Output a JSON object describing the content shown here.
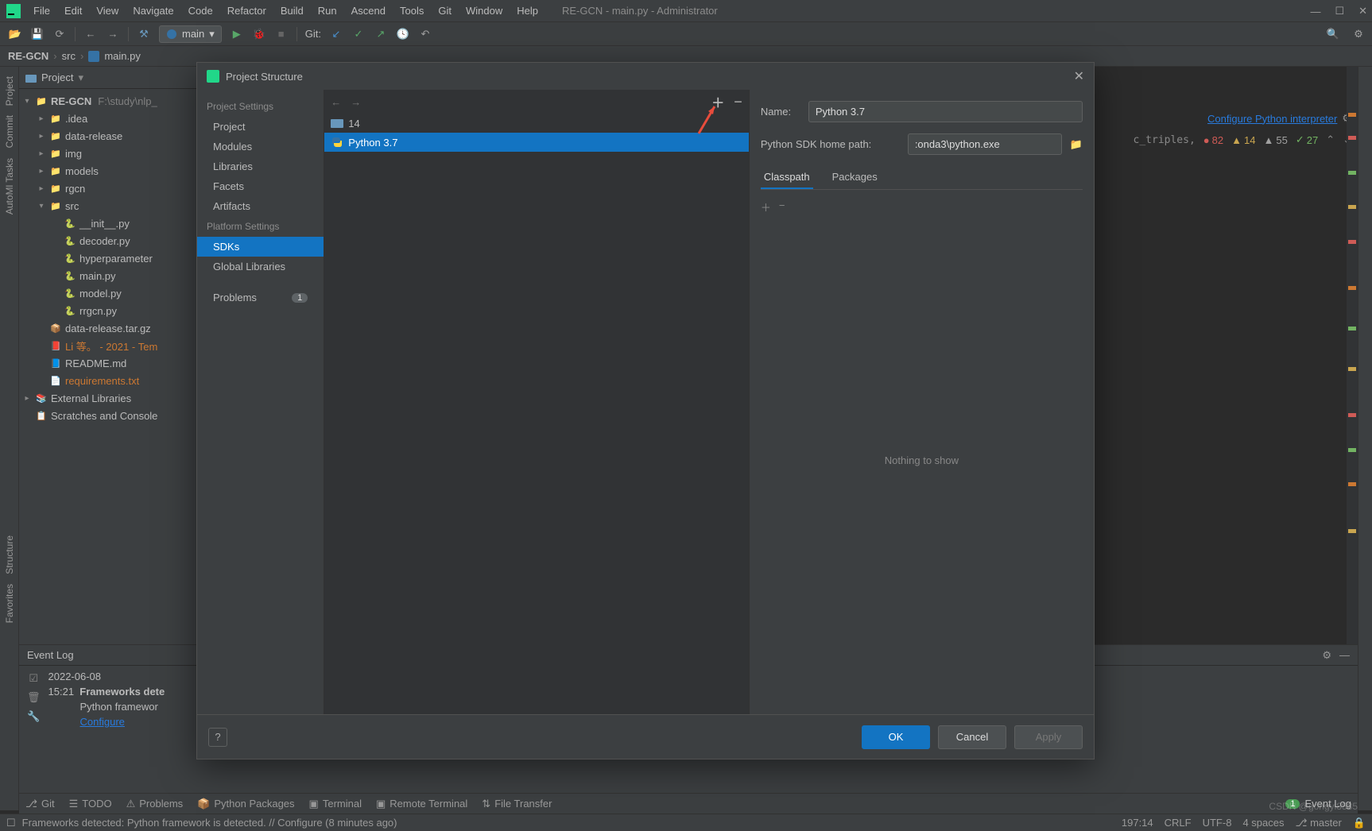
{
  "window": {
    "title": "RE-GCN - main.py - Administrator"
  },
  "menu": {
    "items": [
      "File",
      "Edit",
      "View",
      "Navigate",
      "Code",
      "Refactor",
      "Build",
      "Run",
      "Ascend",
      "Tools",
      "Git",
      "Window",
      "Help"
    ]
  },
  "toolbar": {
    "git_label": "Git:",
    "run_config": "main"
  },
  "breadcrumbs": {
    "parts": [
      "RE-GCN",
      "src",
      "main.py"
    ]
  },
  "project": {
    "title": "Project",
    "root": {
      "name": "RE-GCN",
      "path": "F:\\study\\nlp_"
    },
    "items": [
      {
        "depth": 1,
        "kind": "folder",
        "name": ".idea",
        "arrow": "▸"
      },
      {
        "depth": 1,
        "kind": "folder",
        "name": "data-release",
        "arrow": "▸"
      },
      {
        "depth": 1,
        "kind": "folder",
        "name": "img",
        "arrow": "▸"
      },
      {
        "depth": 1,
        "kind": "folder",
        "name": "models",
        "arrow": "▸"
      },
      {
        "depth": 1,
        "kind": "folder",
        "name": "rgcn",
        "arrow": "▸"
      },
      {
        "depth": 1,
        "kind": "folder",
        "name": "src",
        "arrow": "▾"
      },
      {
        "depth": 2,
        "kind": "py",
        "name": "__init__.py"
      },
      {
        "depth": 2,
        "kind": "py",
        "name": "decoder.py"
      },
      {
        "depth": 2,
        "kind": "py",
        "name": "hyperparameter"
      },
      {
        "depth": 2,
        "kind": "py",
        "name": "main.py"
      },
      {
        "depth": 2,
        "kind": "py",
        "name": "model.py"
      },
      {
        "depth": 2,
        "kind": "py",
        "name": "rrgcn.py"
      },
      {
        "depth": 1,
        "kind": "zip",
        "name": "data-release.tar.gz"
      },
      {
        "depth": 1,
        "kind": "pdf",
        "name": "Li 等。 - 2021 - Tem",
        "hl": true
      },
      {
        "depth": 1,
        "kind": "md",
        "name": "README.md"
      },
      {
        "depth": 1,
        "kind": "txt",
        "name": "requirements.txt",
        "hl": true
      }
    ],
    "external": "External Libraries",
    "scratches": "Scratches and Console"
  },
  "editor": {
    "configure_link": "Configure Python interpreter",
    "code_snip": "c_triples,",
    "inspections": {
      "errors": "82",
      "warnings": "14",
      "weak": "55",
      "typos": "27"
    }
  },
  "eventlog": {
    "title": "Event Log",
    "date": "2022-06-08",
    "time": "15:21",
    "heading": "Frameworks dete",
    "line2": "Python framewor",
    "configure": "Configure"
  },
  "bottom_tabs": {
    "git": "Git",
    "todo": "TODO",
    "problems": "Problems",
    "pypkg": "Python Packages",
    "terminal": "Terminal",
    "remote": "Remote Terminal",
    "filetransfer": "File Transfer",
    "eventlog": "Event Log",
    "eventlog_badge": "1"
  },
  "statusbar": {
    "msg": "Frameworks detected: Python framework is detected. // Configure (8 minutes ago)",
    "pos": "197:14",
    "eol": "CRLF",
    "enc": "UTF-8",
    "indent": "4 spaces",
    "branch": "master"
  },
  "dialog": {
    "title": "Project Structure",
    "nav": {
      "project_settings": "Project Settings",
      "project": "Project",
      "modules": "Modules",
      "libraries": "Libraries",
      "facets": "Facets",
      "artifacts": "Artifacts",
      "platform_settings": "Platform Settings",
      "sdks": "SDKs",
      "global_libraries": "Global Libraries",
      "problems": "Problems",
      "problems_badge": "1"
    },
    "sdks": [
      {
        "name": "14",
        "icon": "folder"
      },
      {
        "name": "Python 3.7",
        "icon": "python",
        "selected": true
      }
    ],
    "right": {
      "name_label": "Name:",
      "name_value": "Python 3.7",
      "path_label": "Python SDK home path:",
      "path_value": ":onda3\\python.exe",
      "tabs": {
        "classpath": "Classpath",
        "packages": "Packages"
      },
      "empty": "Nothing to show"
    },
    "footer": {
      "ok": "OK",
      "cancel": "Cancel",
      "apply": "Apply",
      "help": "?"
    }
  },
  "left_stripe": {
    "project": "Project",
    "commit": "Commit",
    "automl": "AutoMl Tasks",
    "structure": "Structure",
    "favorites": "Favorites"
  },
  "watermark": "CSDN @gongyi8585"
}
